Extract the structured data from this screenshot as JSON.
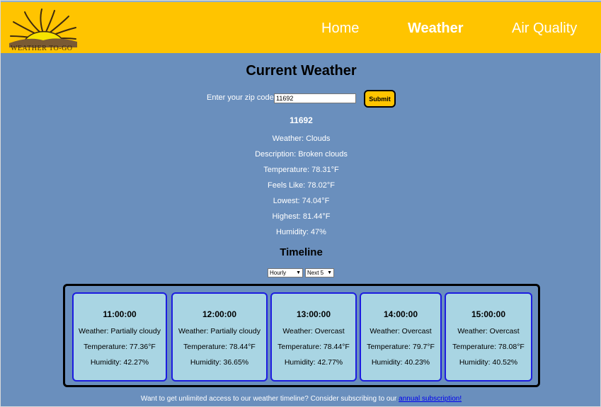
{
  "nav": {
    "logo_text": "WEATHER TO-GO",
    "home": "Home",
    "weather": "Weather",
    "air_quality": "Air Quality"
  },
  "page": {
    "title": "Current Weather"
  },
  "zip": {
    "label": "Enter your zip code:",
    "value": "11692",
    "submit": "Submit"
  },
  "current": {
    "zip_heading": "11692",
    "lines": [
      "Weather: Clouds",
      "Description: Broken clouds",
      "Temperature: 78.31°F",
      "Feels Like: 78.02°F",
      "Lowest: 74.04°F",
      "Highest: 81.44°F",
      "Humidity: 47%"
    ]
  },
  "timeline": {
    "title": "Timeline",
    "interval_select": "Hourly",
    "count_select": "Next 5",
    "cards": [
      {
        "time": "11:00:00",
        "weather": "Weather: Partially cloudy",
        "temperature": "Temperature: 77.36°F",
        "humidity": "Humidity: 42.27%"
      },
      {
        "time": "12:00:00",
        "weather": "Weather: Partially cloudy",
        "temperature": "Temperature: 78.44°F",
        "humidity": "Humidity: 36.65%"
      },
      {
        "time": "13:00:00",
        "weather": "Weather: Overcast",
        "temperature": "Temperature: 78.44°F",
        "humidity": "Humidity: 42.77%"
      },
      {
        "time": "14:00:00",
        "weather": "Weather: Overcast",
        "temperature": "Temperature: 79.7°F",
        "humidity": "Humidity: 40.23%"
      },
      {
        "time": "15:00:00",
        "weather": "Weather: Overcast",
        "temperature": "Temperature: 78.08°F",
        "humidity": "Humidity: 40.52%"
      }
    ]
  },
  "footer": {
    "text": "Want to get unlimited access to our weather timeline? Consider subscribing to our ",
    "link": "annual subscription!"
  },
  "colors": {
    "navbar": "#ffc400",
    "background": "#6a8fbd",
    "card": "#a9d5e3",
    "card_border": "#1c1ce0"
  }
}
